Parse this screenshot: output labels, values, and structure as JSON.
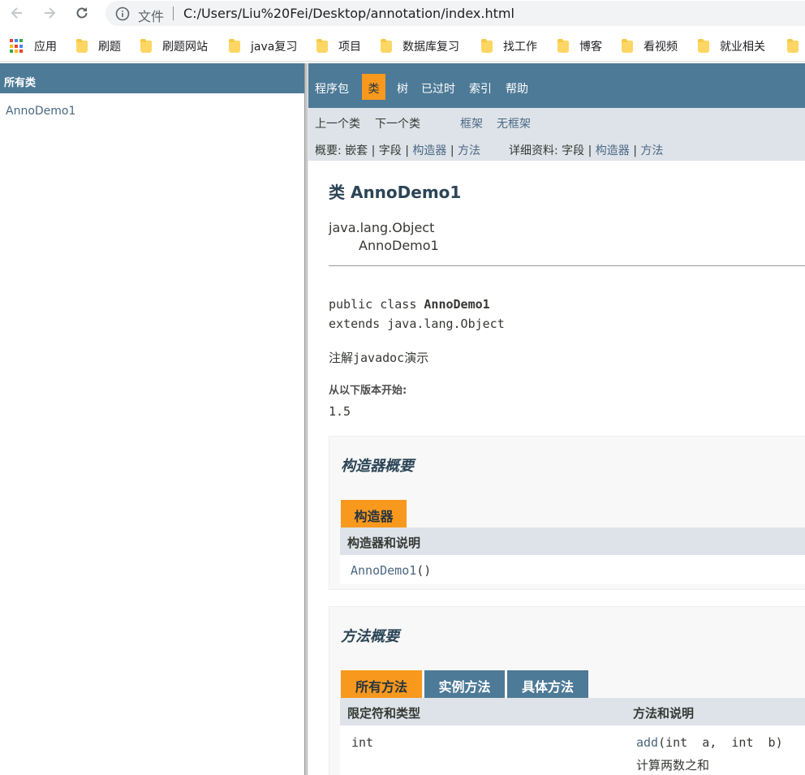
{
  "browser": {
    "file_label": "文件",
    "url": "C:/Users/Liu%20Fei/Desktop/annotation/index.html",
    "bookmarks": [
      "应用",
      "刷题",
      "刷题网站",
      "java复习",
      "项目",
      "数据库复习",
      "找工作",
      "博客",
      "看视频",
      "就业相关"
    ]
  },
  "left": {
    "header": "所有类",
    "classes": [
      "AnnoDemo1"
    ]
  },
  "topnav": {
    "items": [
      "程序包",
      "类",
      "树",
      "已过时",
      "索引",
      "帮助"
    ],
    "active": "类"
  },
  "subnav": {
    "prev_class": "上一个类",
    "next_class": "下一个类",
    "frames": "框架",
    "no_frames": "无框架",
    "summary_prefix": "概要:",
    "summary_nested": "嵌套",
    "summary_field": "字段",
    "summary_constructor": "构造器",
    "summary_method": "方法",
    "detail_prefix": "详细资料:",
    "detail_field": "字段",
    "detail_constructor": "构造器",
    "detail_method": "方法",
    "separator": "|"
  },
  "class": {
    "title": "类 AnnoDemo1",
    "inheritance_root": "java.lang.Object",
    "inheritance_child": "AnnoDemo1",
    "signature_prefix": "public class ",
    "signature_name": "AnnoDemo1",
    "signature_extends": "extends java.lang.Object",
    "description": "注解javadoc演示",
    "since_label": "从以下版本开始:",
    "since_value": "1.5"
  },
  "constructor_summary": {
    "title": "构造器概要",
    "tab": "构造器",
    "column": "构造器和说明",
    "rows": [
      {
        "name": "AnnoDemo1",
        "params": "()"
      }
    ]
  },
  "method_summary": {
    "title": "方法概要",
    "tabs": [
      "所有方法",
      "实例方法",
      "具体方法"
    ],
    "columns": [
      "限定符和类型",
      "方法和说明"
    ],
    "rows": [
      {
        "type": "int",
        "name": "add",
        "params": "(int  a,  int  b)",
        "description": "计算两数之和"
      }
    ]
  },
  "colors": {
    "nav_blue": "#4d7a97",
    "nav_orange": "#f8981d",
    "subnav_gray": "#dee3e9",
    "link": "#4a6782"
  }
}
